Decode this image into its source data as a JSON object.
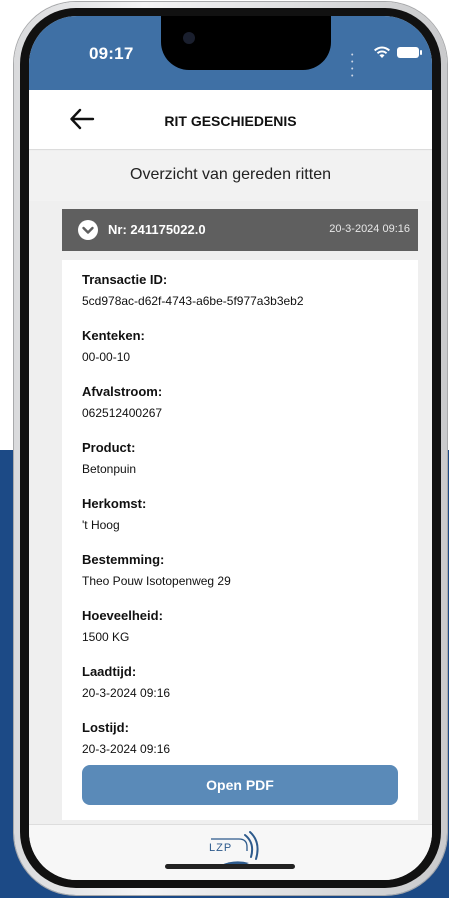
{
  "status": {
    "time": "09:17"
  },
  "nav": {
    "title": "RIT GESCHIEDENIS"
  },
  "subtitle": "Overzicht van gereden ritten",
  "trip": {
    "number": "Nr: 241175022.0",
    "date": "20-3-2024 09:16",
    "fields": [
      {
        "label": "Transactie ID:",
        "value": "5cd978ac-d62f-4743-a6be-5f977a3b3eb2"
      },
      {
        "label": "Kenteken:",
        "value": "00-00-10"
      },
      {
        "label": "Afvalstroom:",
        "value": "062512400267"
      },
      {
        "label": "Product:",
        "value": "Betonpuin"
      },
      {
        "label": "Herkomst:",
        "value": "'t Hoog"
      },
      {
        "label": "Bestemming:",
        "value": "Theo Pouw Isotopenweg 29"
      },
      {
        "label": "Hoeveelheid:",
        "value": "1500 KG"
      },
      {
        "label": "Laadtijd:",
        "value": "20-3-2024 09:16"
      },
      {
        "label": "Lostijd:",
        "value": "20-3-2024 09:16"
      }
    ],
    "pdf_button": "Open PDF"
  },
  "footer": {
    "logo_text": "LZP"
  },
  "icons": {
    "back": "arrow-left-icon",
    "expand": "chevron-down-icon",
    "wifi": "wifi-icon",
    "battery": "battery-icon"
  },
  "colors": {
    "header_blue": "#3f70a5",
    "card_header_gray": "#5f5f5f",
    "button_blue": "#5a8ab8",
    "background_navy": "#1c4a86"
  }
}
